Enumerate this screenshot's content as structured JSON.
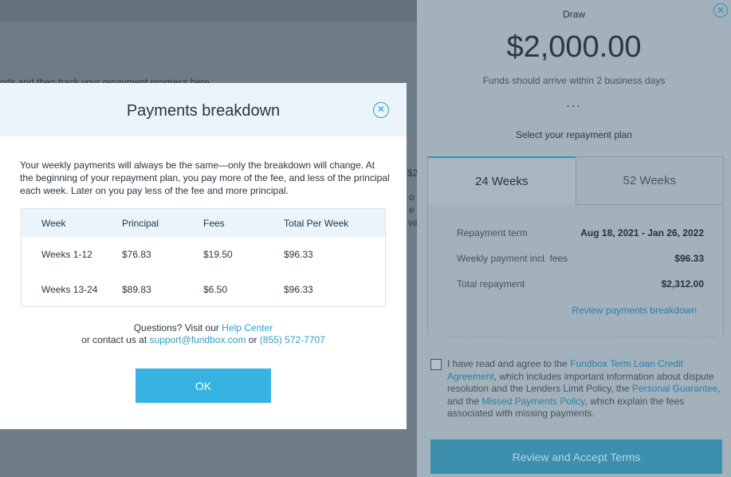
{
  "background": {
    "line_text": "nds and then track your repayment progress here.",
    "fragments": [
      "$2",
      "o",
      "e",
      "va"
    ]
  },
  "panel": {
    "close_icon": "close-icon",
    "title": "Draw",
    "amount": "$2,000.00",
    "subtitle": "Funds should arrive within 2 business days",
    "dots": "...",
    "select_label": "Select your repayment plan",
    "tabs": [
      {
        "label": "24 Weeks",
        "active": true
      },
      {
        "label": "52 Weeks",
        "active": false
      }
    ],
    "details": [
      {
        "label": "Repayment term",
        "value": "Aug 18, 2021 - Jan 26, 2022"
      },
      {
        "label": "Weekly payment incl. fees",
        "value": "$96.33"
      },
      {
        "label": "Total repayment",
        "value": "$2,312.00"
      }
    ],
    "review_link": "Review payments breakdown",
    "agreement": {
      "t1": "I have read and agree to the ",
      "l1": "Fundbox Term Loan Credit Agreement",
      "t2": ", which includes important information about dispute resolution and the Lenders Limit Policy, the ",
      "l2": "Personal Guarantee",
      "t3": ", and the ",
      "l3": "Missed Payments Policy",
      "t4": ", which explain the fees associated with missing payments."
    },
    "accept_button": "Review and Accept Terms"
  },
  "modal": {
    "title": "Payments breakdown",
    "close_icon": "close-icon",
    "intro": "Your weekly payments will always be the same—only the breakdown will change. At the beginning of your repayment plan, you pay more of the fee, and less of the principal each week. Later on you pay less of the fee and more principal.",
    "table": {
      "headers": [
        "Week",
        "Principal",
        "Fees",
        "Total Per Week"
      ],
      "rows": [
        [
          "Weeks 1-12",
          "$76.83",
          "$19.50",
          "$96.33"
        ],
        [
          "Weeks 13-24",
          "$89.83",
          "$6.50",
          "$96.33"
        ]
      ]
    },
    "help": {
      "t1": "Questions? Visit our ",
      "help_center": "Help Center",
      "t2": "or contact us at ",
      "email": "support@fundbox.com",
      "t3": " or ",
      "phone": "(855) 572-7707"
    },
    "ok_button": "OK"
  }
}
